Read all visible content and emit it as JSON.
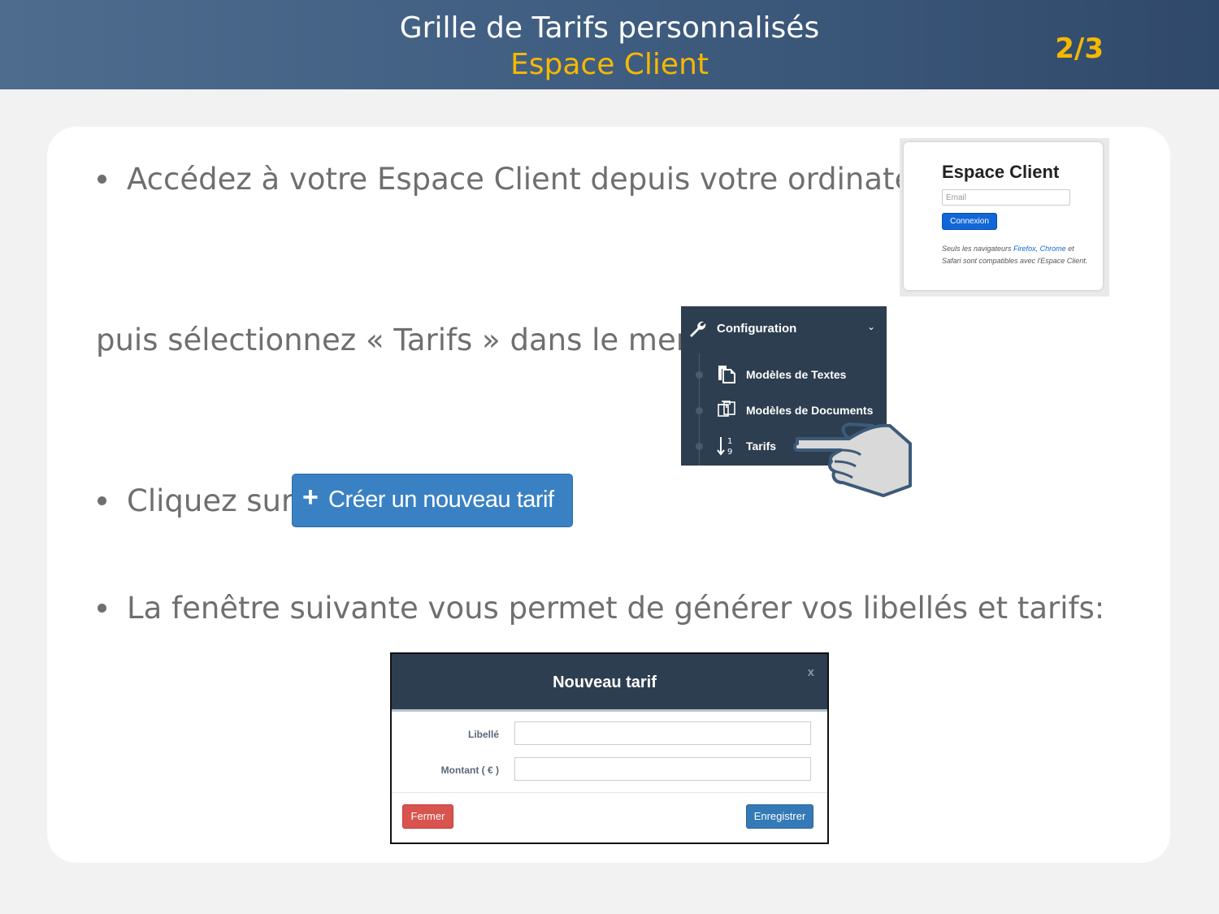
{
  "header": {
    "title": "Grille de Tarifs personnalisés",
    "subtitle": "Espace Client",
    "page_indicator": "2/3"
  },
  "steps": {
    "step1": "Accédez à votre Espace Client depuis votre ordinateur:",
    "step1_cont": "puis sélectionnez « Tarifs » dans le menu :",
    "step2": "Cliquez sur",
    "step3": "La fenêtre suivante vous permet de générer vos libellés et tarifs:"
  },
  "login_panel": {
    "title": "Espace Client",
    "email_placeholder": "Email",
    "connect_label": "Connexion",
    "note_prefix": "Seuls les navigateurs ",
    "firefox": "Firefox",
    "comma": ", ",
    "chrome": "Chrome",
    "note_suffix": " et Safari sont compatibles avec l'Espace Client."
  },
  "menu": {
    "header_label": "Configuration",
    "items": [
      {
        "label": "Modèles de Textes",
        "icon": "document-stack-icon"
      },
      {
        "label": "Modèles de Documents",
        "icon": "documents-copy-icon"
      },
      {
        "label": "Tarifs",
        "icon": "sort-numeric-icon"
      }
    ]
  },
  "create_button": {
    "plus": "+",
    "label": "Créer un nouveau tarif"
  },
  "modal": {
    "title": "Nouveau tarif",
    "close": "x",
    "fields": [
      {
        "label": "Libellé",
        "value": ""
      },
      {
        "label": "Montant ( € )",
        "value": ""
      }
    ],
    "close_button": "Fermer",
    "save_button": "Enregistrer"
  },
  "colors": {
    "header_bg": "#3f5d80",
    "accent_yellow": "#f5b800",
    "menu_bg": "#2d3e50",
    "primary_blue": "#337ab7",
    "danger_red": "#d9534f",
    "text_gray": "#6f6f6f"
  }
}
